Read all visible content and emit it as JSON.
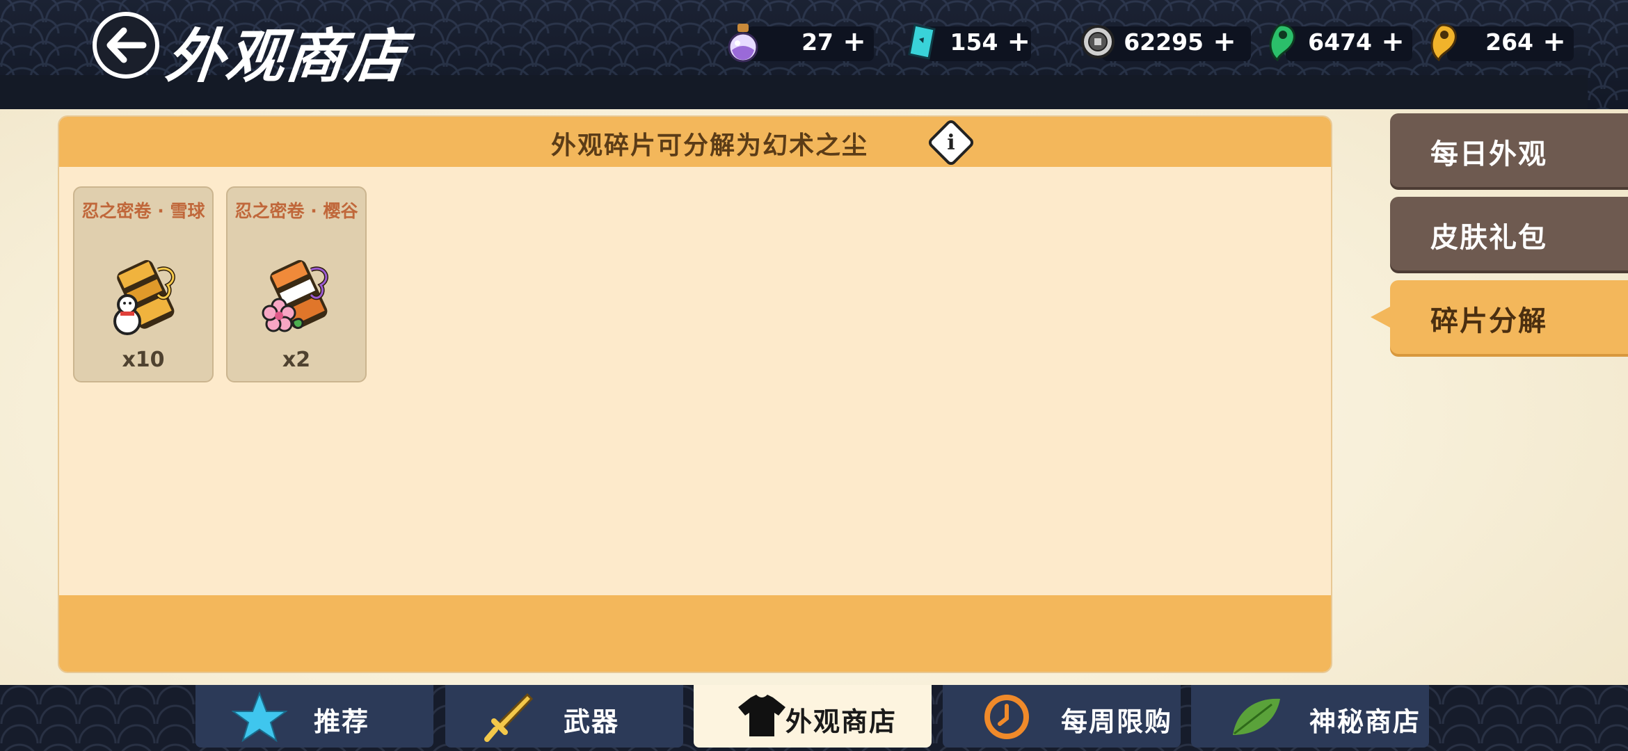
{
  "header": {
    "title": "外观商店",
    "currencies": [
      {
        "icon": "potion-icon",
        "value": "27"
      },
      {
        "icon": "ticket-icon",
        "value": "154"
      },
      {
        "icon": "coin-icon",
        "value": "62295"
      },
      {
        "icon": "green-magatama-icon",
        "value": "6474"
      },
      {
        "icon": "gold-magatama-icon",
        "value": "264"
      }
    ],
    "plus_label": "+"
  },
  "panel": {
    "title": "外观碎片可分解为幻术之尘",
    "info_label": "i",
    "items": [
      {
        "name": "忍之密卷 · 雪球",
        "qty": "x10"
      },
      {
        "name": "忍之密卷 · 樱谷",
        "qty": "x2"
      }
    ]
  },
  "side_tabs": [
    {
      "label": "每日外观",
      "active": false
    },
    {
      "label": "皮肤礼包",
      "active": false
    },
    {
      "label": "碎片分解",
      "active": true
    }
  ],
  "bottom_nav": [
    {
      "label": "推荐",
      "icon": "star-icon",
      "active": false
    },
    {
      "label": "武器",
      "icon": "sword-icon",
      "active": false
    },
    {
      "label": "外观商店",
      "icon": "shirt-icon",
      "active": true
    },
    {
      "label": "每周限购",
      "icon": "clock-icon",
      "active": false
    },
    {
      "label": "神秘商店",
      "icon": "leaf-icon",
      "active": false
    }
  ],
  "colors": {
    "accent": "#f3b75b",
    "panel_bg": "#fdeacb",
    "tab_inactive": "#6e5a50",
    "nav_bg": "#2c3a58"
  }
}
